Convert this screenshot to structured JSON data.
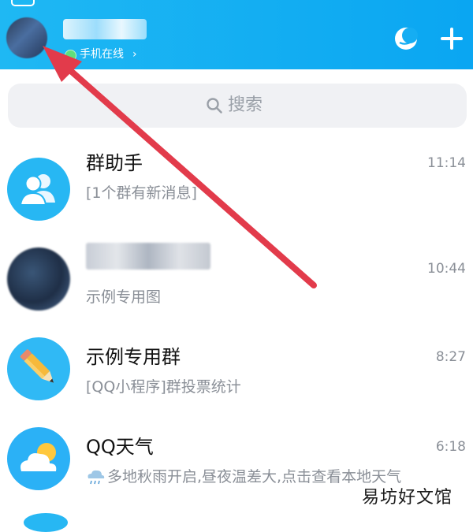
{
  "header": {
    "online_status": "手机在线",
    "online_chevron": "›"
  },
  "search": {
    "placeholder": "搜索"
  },
  "chats": [
    {
      "title": "群助手",
      "message": "[1个群有新消息]",
      "time": "11:14",
      "avatar_icon": "group-people-icon"
    },
    {
      "title": "",
      "message": "示例专用图",
      "time": "10:44",
      "avatar_icon": "blurred-avatar"
    },
    {
      "title": "示例专用群",
      "message": "[QQ小程序]群投票统计",
      "time": "8:27",
      "avatar_icon": "pencil-icon"
    },
    {
      "title": "QQ天气",
      "message": "多地秋雨开启,昼夜温差大,点击查看本地天气",
      "time": "6:18",
      "avatar_icon": "cloud-sun-icon"
    }
  ],
  "watermark": "易坊好文馆",
  "colors": {
    "header": "#1fb8f3",
    "online_dot": "#5ee07d",
    "arrow": "#e23b4b"
  }
}
